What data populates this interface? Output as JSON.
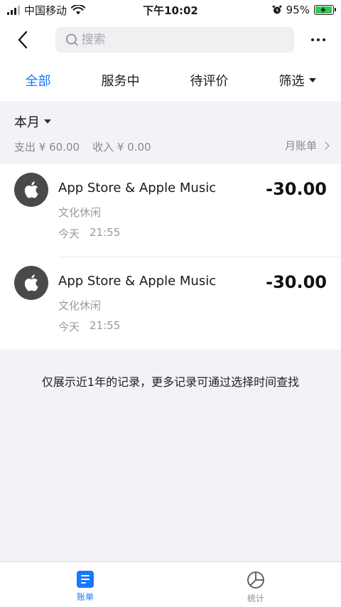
{
  "status_bar": {
    "carrier": "中国移动",
    "time": "下午10:02",
    "battery": "95%",
    "battery_level": 0.95
  },
  "nav": {
    "search_placeholder": "搜索"
  },
  "tabs": [
    {
      "label": "全部",
      "active": true
    },
    {
      "label": "服务中",
      "active": false
    },
    {
      "label": "待评价",
      "active": false
    },
    {
      "label": "筛选",
      "active": false
    }
  ],
  "month": {
    "title": "本月",
    "expense_label": "支出",
    "expense_value": "¥ 60.00",
    "income_label": "收入",
    "income_value": "¥ 0.00",
    "bill_link": "月账单"
  },
  "transactions": [
    {
      "name": "App Store & Apple Music",
      "category": "文化休闲",
      "day": "今天",
      "time": "21:55",
      "amount": "-30.00"
    },
    {
      "name": "App Store & Apple Music",
      "category": "文化休闲",
      "day": "今天",
      "time": "21:55",
      "amount": "-30.00"
    }
  ],
  "note": "仅展示近1年的记录，更多记录可通过选择时间查找",
  "bottom_tabs": [
    {
      "label": "账单",
      "active": true
    },
    {
      "label": "统计",
      "active": false
    }
  ],
  "colors": {
    "accent": "#1677ff",
    "battery": "#34c759"
  }
}
